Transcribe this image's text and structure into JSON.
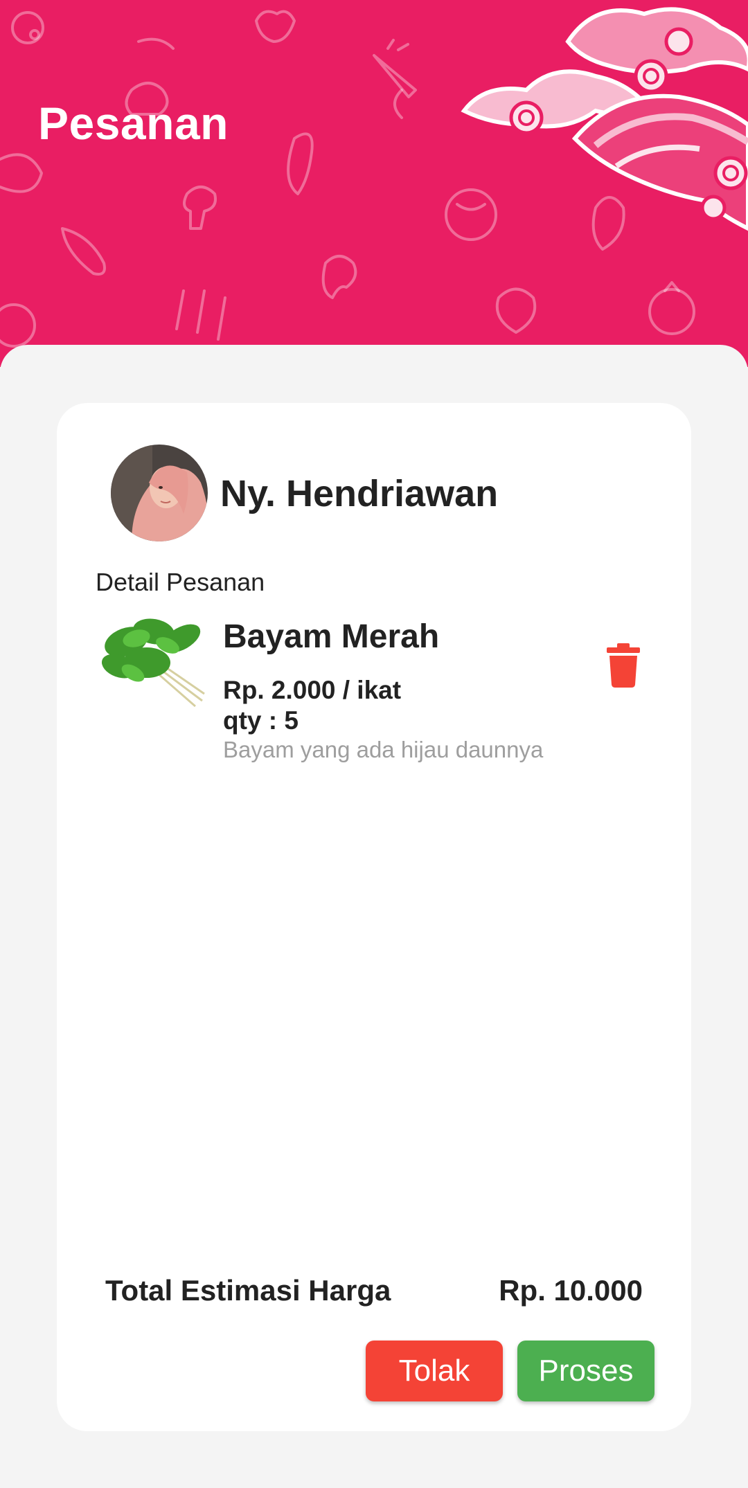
{
  "header": {
    "title": "Pesanan",
    "background_color": "#e91e63"
  },
  "order": {
    "customer": {
      "name": "Ny. Hendriawan",
      "avatar": "customer-avatar-photo"
    },
    "section_label": "Detail Pesanan",
    "items": [
      {
        "name": "Bayam Merah",
        "price": "Rp. 2.000 / ikat",
        "qty": "qty : 5",
        "description": "Bayam yang ada hijau daunnya",
        "image": "spinach-bunch-photo",
        "delete_icon": "trash-icon"
      }
    ],
    "total_label": "Total Estimasi Harga",
    "total_value": "Rp. 10.000"
  },
  "actions": {
    "reject_label": "Tolak",
    "process_label": "Proses",
    "reject_color": "#f44336",
    "process_color": "#4caf50"
  }
}
